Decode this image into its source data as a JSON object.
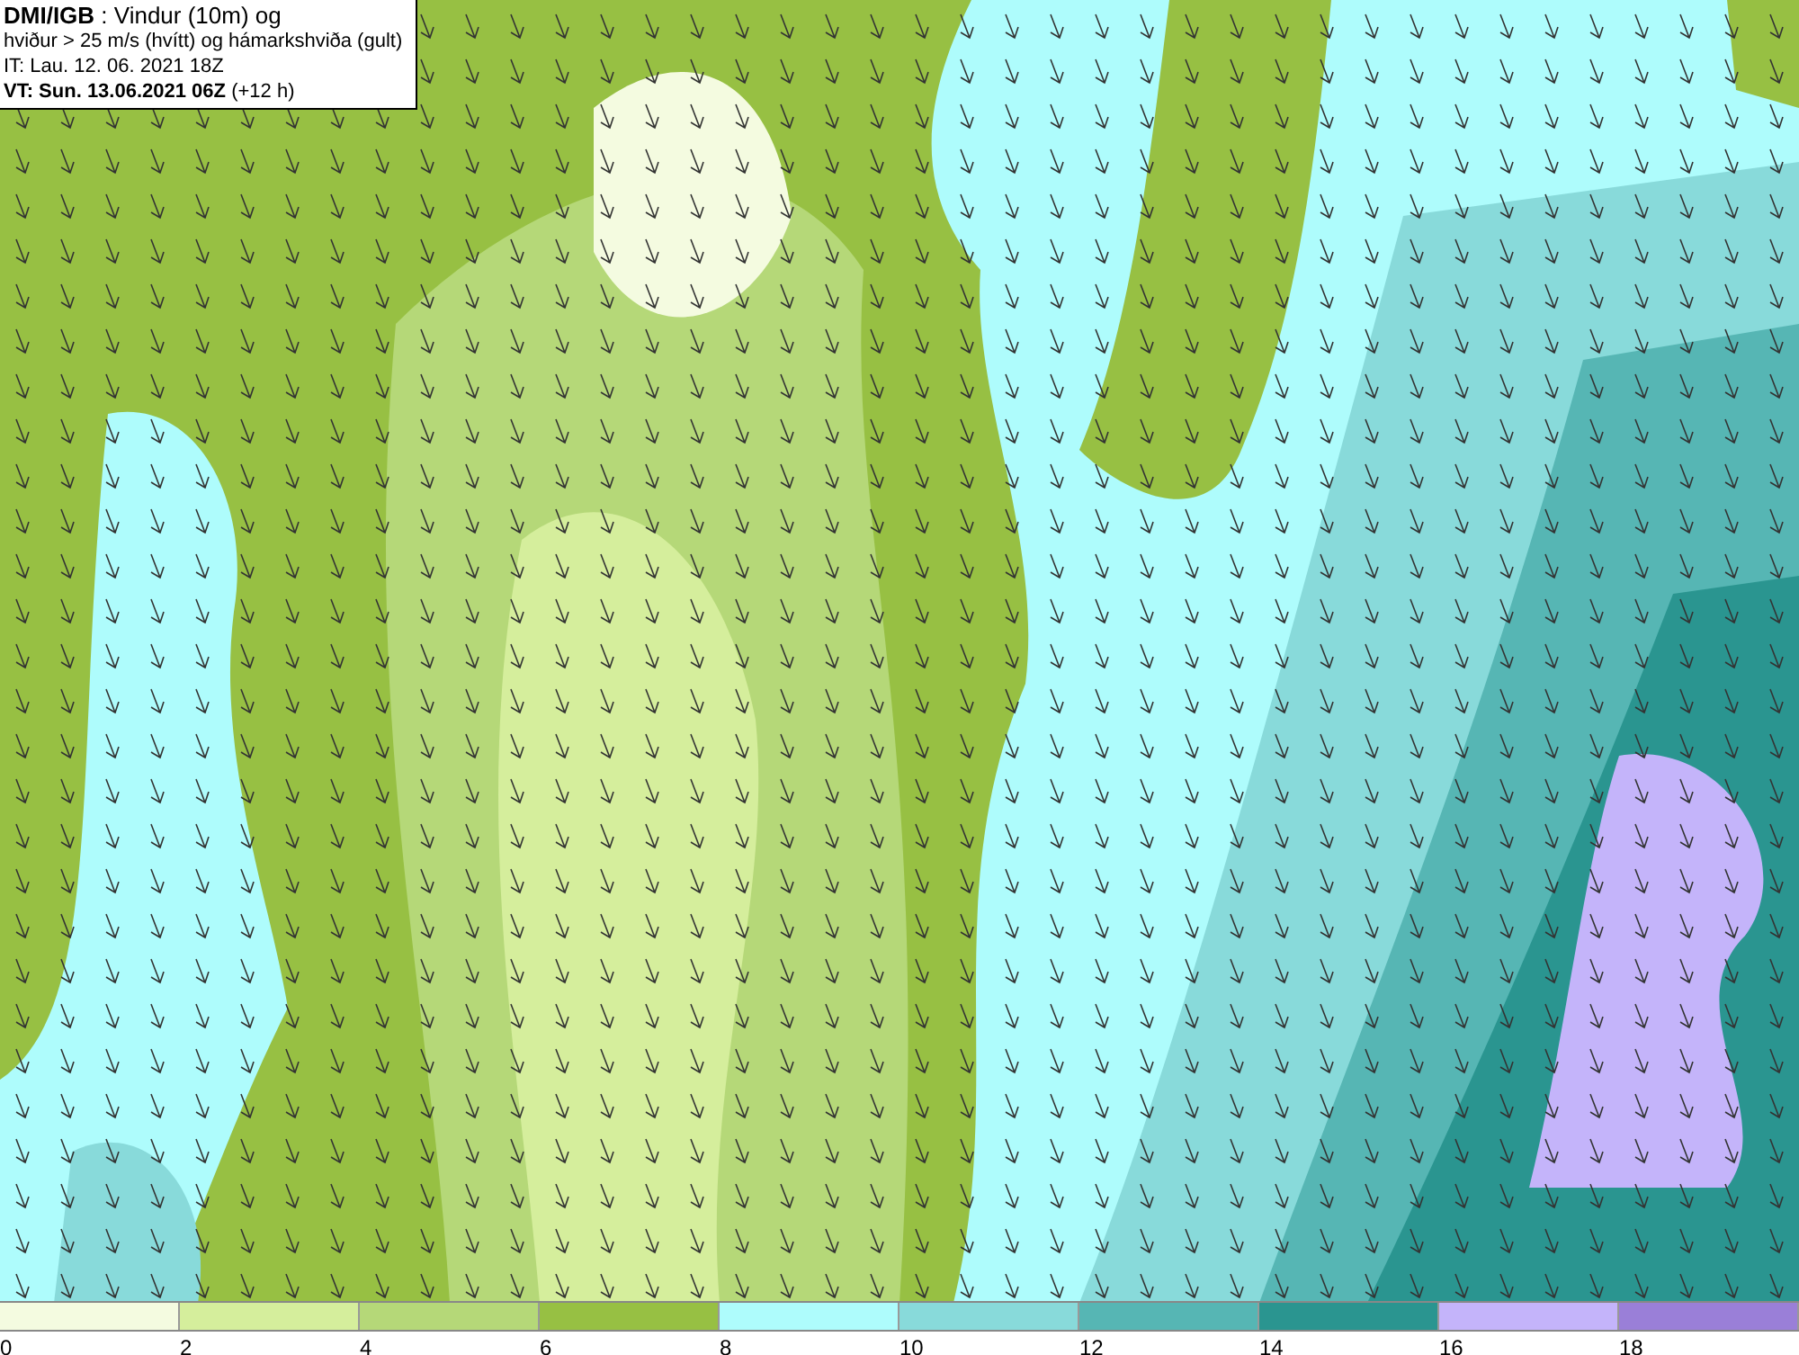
{
  "header": {
    "lines": [
      "**DMI/IGB** : Vindur (10m) og",
      "hviður > 25 m/s (hvítt) og hámarkshviða (gult)",
      "IT: Lau. 12. 06. 2021 18Z",
      "**VT: Sun. 13.06.2021 06Z** (+12 h)"
    ]
  },
  "legend": [
    {
      "label": "0",
      "color": "#f4fbe0"
    },
    {
      "label": "2",
      "color": "#d5ee9c"
    },
    {
      "label": "4",
      "color": "#b5d878"
    },
    {
      "label": "6",
      "color": "#97c043"
    },
    {
      "label": "8",
      "color": "#aefcfc"
    },
    {
      "label": "10",
      "color": "#88dada"
    },
    {
      "label": "12",
      "color": "#56b6b4"
    },
    {
      "label": "14",
      "color": "#2a9590"
    },
    {
      "label": "16",
      "color": "#c4b4fa"
    },
    {
      "label": "18",
      "color": "#9a7fd8"
    }
  ]
}
